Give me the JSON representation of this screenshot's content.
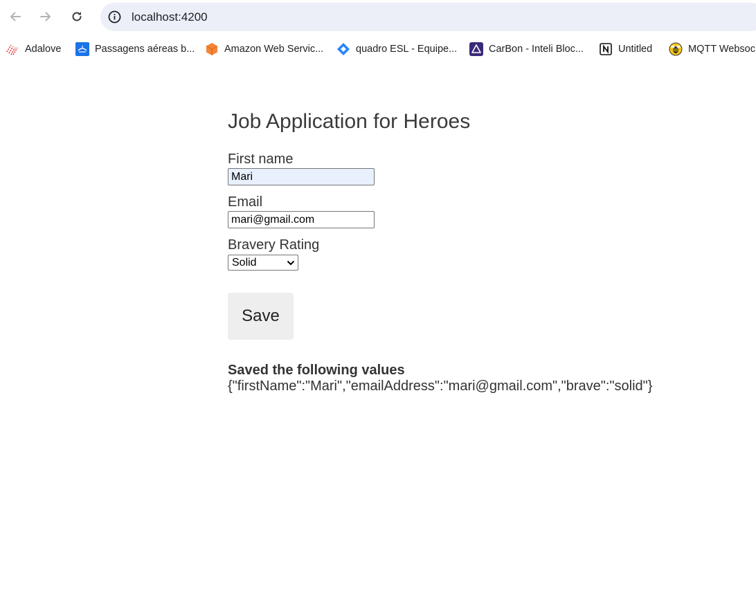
{
  "browser": {
    "url": "localhost:4200",
    "bookmarks": [
      {
        "label": "Adalove",
        "icon": "adalove-icon"
      },
      {
        "label": "Passagens aéreas b...",
        "icon": "airline-icon"
      },
      {
        "label": "Amazon Web Servic...",
        "icon": "aws-cube-icon"
      },
      {
        "label": "quadro ESL - Equipe...",
        "icon": "jira-icon"
      },
      {
        "label": "CarBon - Inteli Bloc...",
        "icon": "triangle-icon"
      },
      {
        "label": "Untitled",
        "icon": "notion-icon"
      },
      {
        "label": "MQTT Websoc",
        "icon": "mqtt-bee-icon"
      }
    ]
  },
  "form": {
    "title": "Job Application for Heroes",
    "first_name": {
      "label": "First name",
      "value": "Mari"
    },
    "email": {
      "label": "Email",
      "value": "mari@gmail.com"
    },
    "bravery": {
      "label": "Bravery Rating",
      "selected": "Solid"
    },
    "save_label": "Save"
  },
  "result": {
    "heading": "Saved the following values",
    "json": "{\"firstName\":\"Mari\",\"emailAddress\":\"mari@gmail.com\",\"brave\":\"solid\"}"
  },
  "colors": {
    "omnibox": "#eceff7",
    "autofill": "#e8f0fe",
    "button": "#eeeeee"
  }
}
